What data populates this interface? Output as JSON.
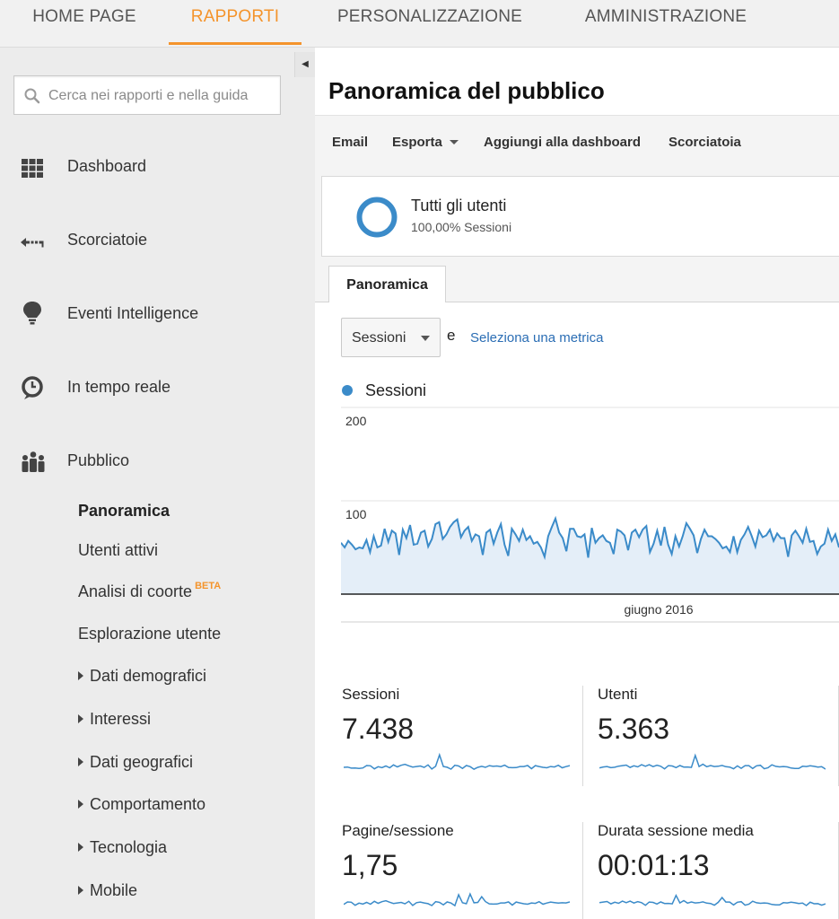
{
  "topnav": {
    "tabs": [
      {
        "label": "HOME PAGE",
        "active": false
      },
      {
        "label": "RAPPORTI",
        "active": true
      },
      {
        "label": "PERSONALIZZAZIONE",
        "active": false
      },
      {
        "label": "AMMINISTRAZIONE",
        "active": false
      }
    ]
  },
  "colors": {
    "accent": "#f4942c",
    "chart_line": "#3b8bc9",
    "link": "#2a6db4"
  },
  "sidebar": {
    "search": {
      "placeholder": "Cerca nei rapporti e nella guida",
      "icon": "search-icon"
    },
    "items": [
      {
        "label": "Dashboard",
        "icon": "dashboard-grid-icon"
      },
      {
        "label": "Scorciatoie",
        "icon": "shortcut-arrow-icon"
      },
      {
        "label": "Eventi Intelligence",
        "icon": "lightbulb-icon"
      },
      {
        "label": "In tempo reale",
        "icon": "clock-icon"
      },
      {
        "label": "Pubblico",
        "icon": "people-icon"
      }
    ],
    "pubblico_sub": [
      {
        "label": "Panoramica",
        "active": true
      },
      {
        "label": "Utenti attivi"
      },
      {
        "label": "Analisi di coorte",
        "badge": "BETA"
      },
      {
        "label": "Esplorazione utente"
      },
      {
        "label": "Dati demografici",
        "expandable": true
      },
      {
        "label": "Interessi",
        "expandable": true
      },
      {
        "label": "Dati geografici",
        "expandable": true
      },
      {
        "label": "Comportamento",
        "expandable": true
      },
      {
        "label": "Tecnologia",
        "expandable": true
      },
      {
        "label": "Mobile",
        "expandable": true
      }
    ]
  },
  "main": {
    "title": "Panoramica del pubblico",
    "toolbar": {
      "email": "Email",
      "export": "Esporta",
      "add_dashboard": "Aggiungi alla dashboard",
      "shortcut": "Scorciatoia"
    },
    "segment": {
      "name": "Tutti gli utenti",
      "detail": "100,00% Sessioni"
    },
    "tab": "Panoramica",
    "metric_selector": {
      "value": "Sessioni",
      "conjunction": "e",
      "add_metric_link": "Seleziona una metrica"
    },
    "legend": {
      "series_name": "Sessioni"
    }
  },
  "chart_data": {
    "type": "area",
    "series": [
      {
        "name": "Sessioni",
        "values": [
          55,
          50,
          57,
          53,
          48,
          50,
          49,
          58,
          45,
          62,
          50,
          52,
          70,
          56,
          68,
          65,
          42,
          69,
          60,
          74,
          53,
          54,
          66,
          68,
          51,
          59,
          75,
          77,
          59,
          64,
          72,
          77,
          80,
          61,
          68,
          72,
          57,
          64,
          62,
          42,
          66,
          69,
          54,
          66,
          75,
          53,
          41,
          70,
          64,
          57,
          69,
          58,
          62,
          54,
          56,
          50,
          40,
          62,
          72,
          81,
          66,
          60,
          46,
          70,
          70,
          62,
          61,
          64,
          39,
          71,
          55,
          60,
          63,
          57,
          55,
          43,
          69,
          67,
          63,
          47,
          66,
          69,
          61,
          69,
          73,
          45,
          54,
          68,
          52,
          72,
          53,
          43,
          62,
          51,
          62,
          76,
          70,
          63,
          44,
          59,
          69,
          62,
          62,
          59,
          55,
          49,
          51,
          45,
          62,
          45,
          58,
          64,
          72,
          62,
          51,
          68,
          61,
          63,
          69,
          57,
          65,
          60,
          60,
          40,
          63,
          68,
          62,
          55,
          70,
          56,
          57,
          43,
          51,
          54,
          69,
          57,
          64,
          50
        ]
      }
    ],
    "x_label": "giugno 2016",
    "y_ticks": [
      100,
      200
    ],
    "ylim": [
      0,
      200
    ]
  },
  "stats": [
    {
      "label": "Sessioni",
      "value": "7.438"
    },
    {
      "label": "Utenti",
      "value": "5.363"
    },
    {
      "label": "Pagine/sessione",
      "value": "1,75"
    },
    {
      "label": "Durata sessione media",
      "value": "00:01:13"
    }
  ]
}
